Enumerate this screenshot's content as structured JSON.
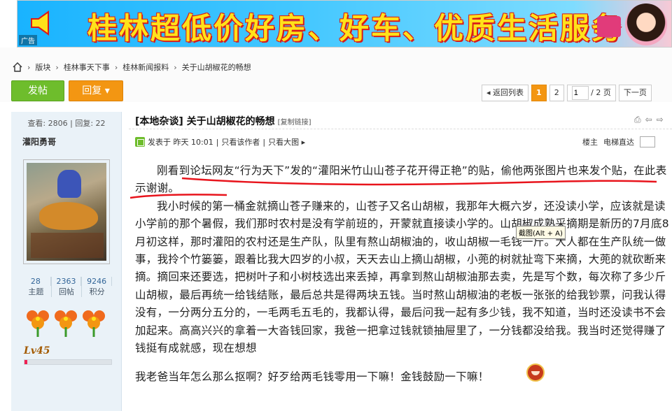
{
  "banner": {
    "ad_label": "广告",
    "text": "桂林超低价好房、好车、优质生活服务"
  },
  "breadcrumb": {
    "items": [
      "版块",
      "桂林事天下事",
      "桂林新闻报料",
      "关于山胡椒花的畅想"
    ]
  },
  "buttons": {
    "post": "发帖",
    "reply": "回复 ▾"
  },
  "pager": {
    "back": "◂ 返回列表",
    "page1": "1",
    "page2": "2",
    "input_value": "1",
    "total": " / 2 页",
    "next": "下一页"
  },
  "user": {
    "stats": "查看: 2806  |  回复: 22",
    "name": "灌阳勇哥",
    "topics_n": "28",
    "topics_l": "主题",
    "posts_n": "2363",
    "posts_l": "回帖",
    "points_n": "9246",
    "points_l": "积分",
    "level": "Lv45",
    "level_progress": 0.03
  },
  "post": {
    "title": "[本地杂谈] 关于山胡椒花的畅想",
    "copy_link": "[复制链接]",
    "posted": "发表于  昨天 10:01",
    "only_author": "只看该作者",
    "only_images": "只看大图 ▸",
    "floor_label": "楼主",
    "elevator": "电梯直达",
    "p1": "刚看到论坛网友“行为天下”发的“灌阳米竹山山苍子花开得正艳”的贴，偷他两张图片也来发个贴，在此表示谢谢。",
    "p2": "我小时候的第一桶金就摘山苍子赚来的，山苍子又名山胡椒，我那年大概六岁，还没读小学，应该就是读小学前的那个暑假，我们那时农村是没有学前班的，开蒙就直接读小学的。山胡椒成熟采摘期是新历的7月底8月初这样，那时灌阳的农村还是生产队，队里有熬山胡椒油的，收山胡椒一毛钱一斤。大人都在生产队统一做事，我拎个竹篓篓，跟着比我大四岁的小叔，天天去山上摘山胡椒，小蔸的树就扯弯下来摘，大蔸的就砍断来摘。摘回来还要选，把树叶子和小树枝选出来丢掉，再拿到熬山胡椒油那去卖，先是写个数，每次称了多少斤山胡椒，最后再统一给钱结账，最后总共是得两块五钱。当时熬山胡椒油的老板一张张的给我钞票，问我认得没有，一分两分五分的，一毛两毛五毛的，我都认得，最后问我一起有多少钱，我不知道，当时还没读书不会加起来。高高兴兴的拿着一大沓钱回家，我爸一把拿过钱就锁抽屉里了，一分钱都没给我。我当时还觉得赚了钱挺有成就感，现在想想",
    "p3": "我老爸当年怎么那么抠啊？好歹给两毛钱零用一下嘛！金钱鼓励一下嘛！"
  },
  "tooltip": "截图(Alt + A)",
  "colors": {
    "green": "#6ebd2c",
    "orange": "#f39612",
    "annotation_red": "#e8141c"
  }
}
